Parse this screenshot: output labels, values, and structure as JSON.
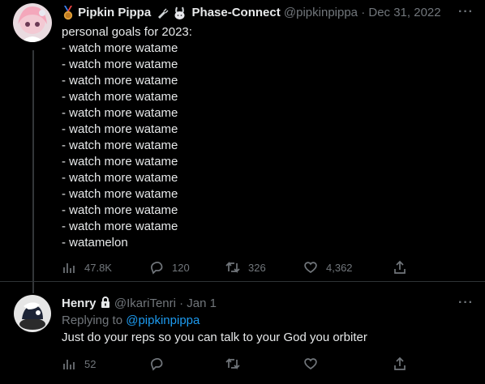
{
  "tweet": {
    "author": {
      "badge_icon": "medal-icon",
      "name": "Pipkin Pippa",
      "emojis": "🔌🐰",
      "affiliation": "Phase-Connect",
      "handle": "@pipkinpippa",
      "separator": "·",
      "date": "Dec 31, 2022"
    },
    "more_label": "···",
    "body_lines": [
      "personal goals for 2023:",
      "- watch more watame",
      "- watch more watame",
      "- watch more watame",
      "- watch more watame",
      "- watch more watame",
      "- watch more watame",
      "- watch more watame",
      "- watch more watame",
      "- watch more watame",
      "- watch more watame",
      "- watch more watame",
      "- watch more watame",
      "- watamelon"
    ],
    "stats": {
      "views": "47.8K",
      "replies": "120",
      "retweets": "326",
      "likes": "4,362"
    }
  },
  "reply": {
    "author": {
      "name": "Henry",
      "lock_icon": "lock-icon",
      "handle": "@IkariTenri",
      "separator": "·",
      "date": "Jan 1"
    },
    "more_label": "···",
    "replying_prefix": "Replying to",
    "replying_handle": "@pipkinpippa",
    "text": "Just do your reps so you can talk to your God you orbiter",
    "stats": {
      "views": "52"
    }
  },
  "colors": {
    "background": "#000000",
    "text": "#e7e9ea",
    "muted": "#71767b",
    "link": "#1d9bf0",
    "divider": "#2f3336"
  }
}
